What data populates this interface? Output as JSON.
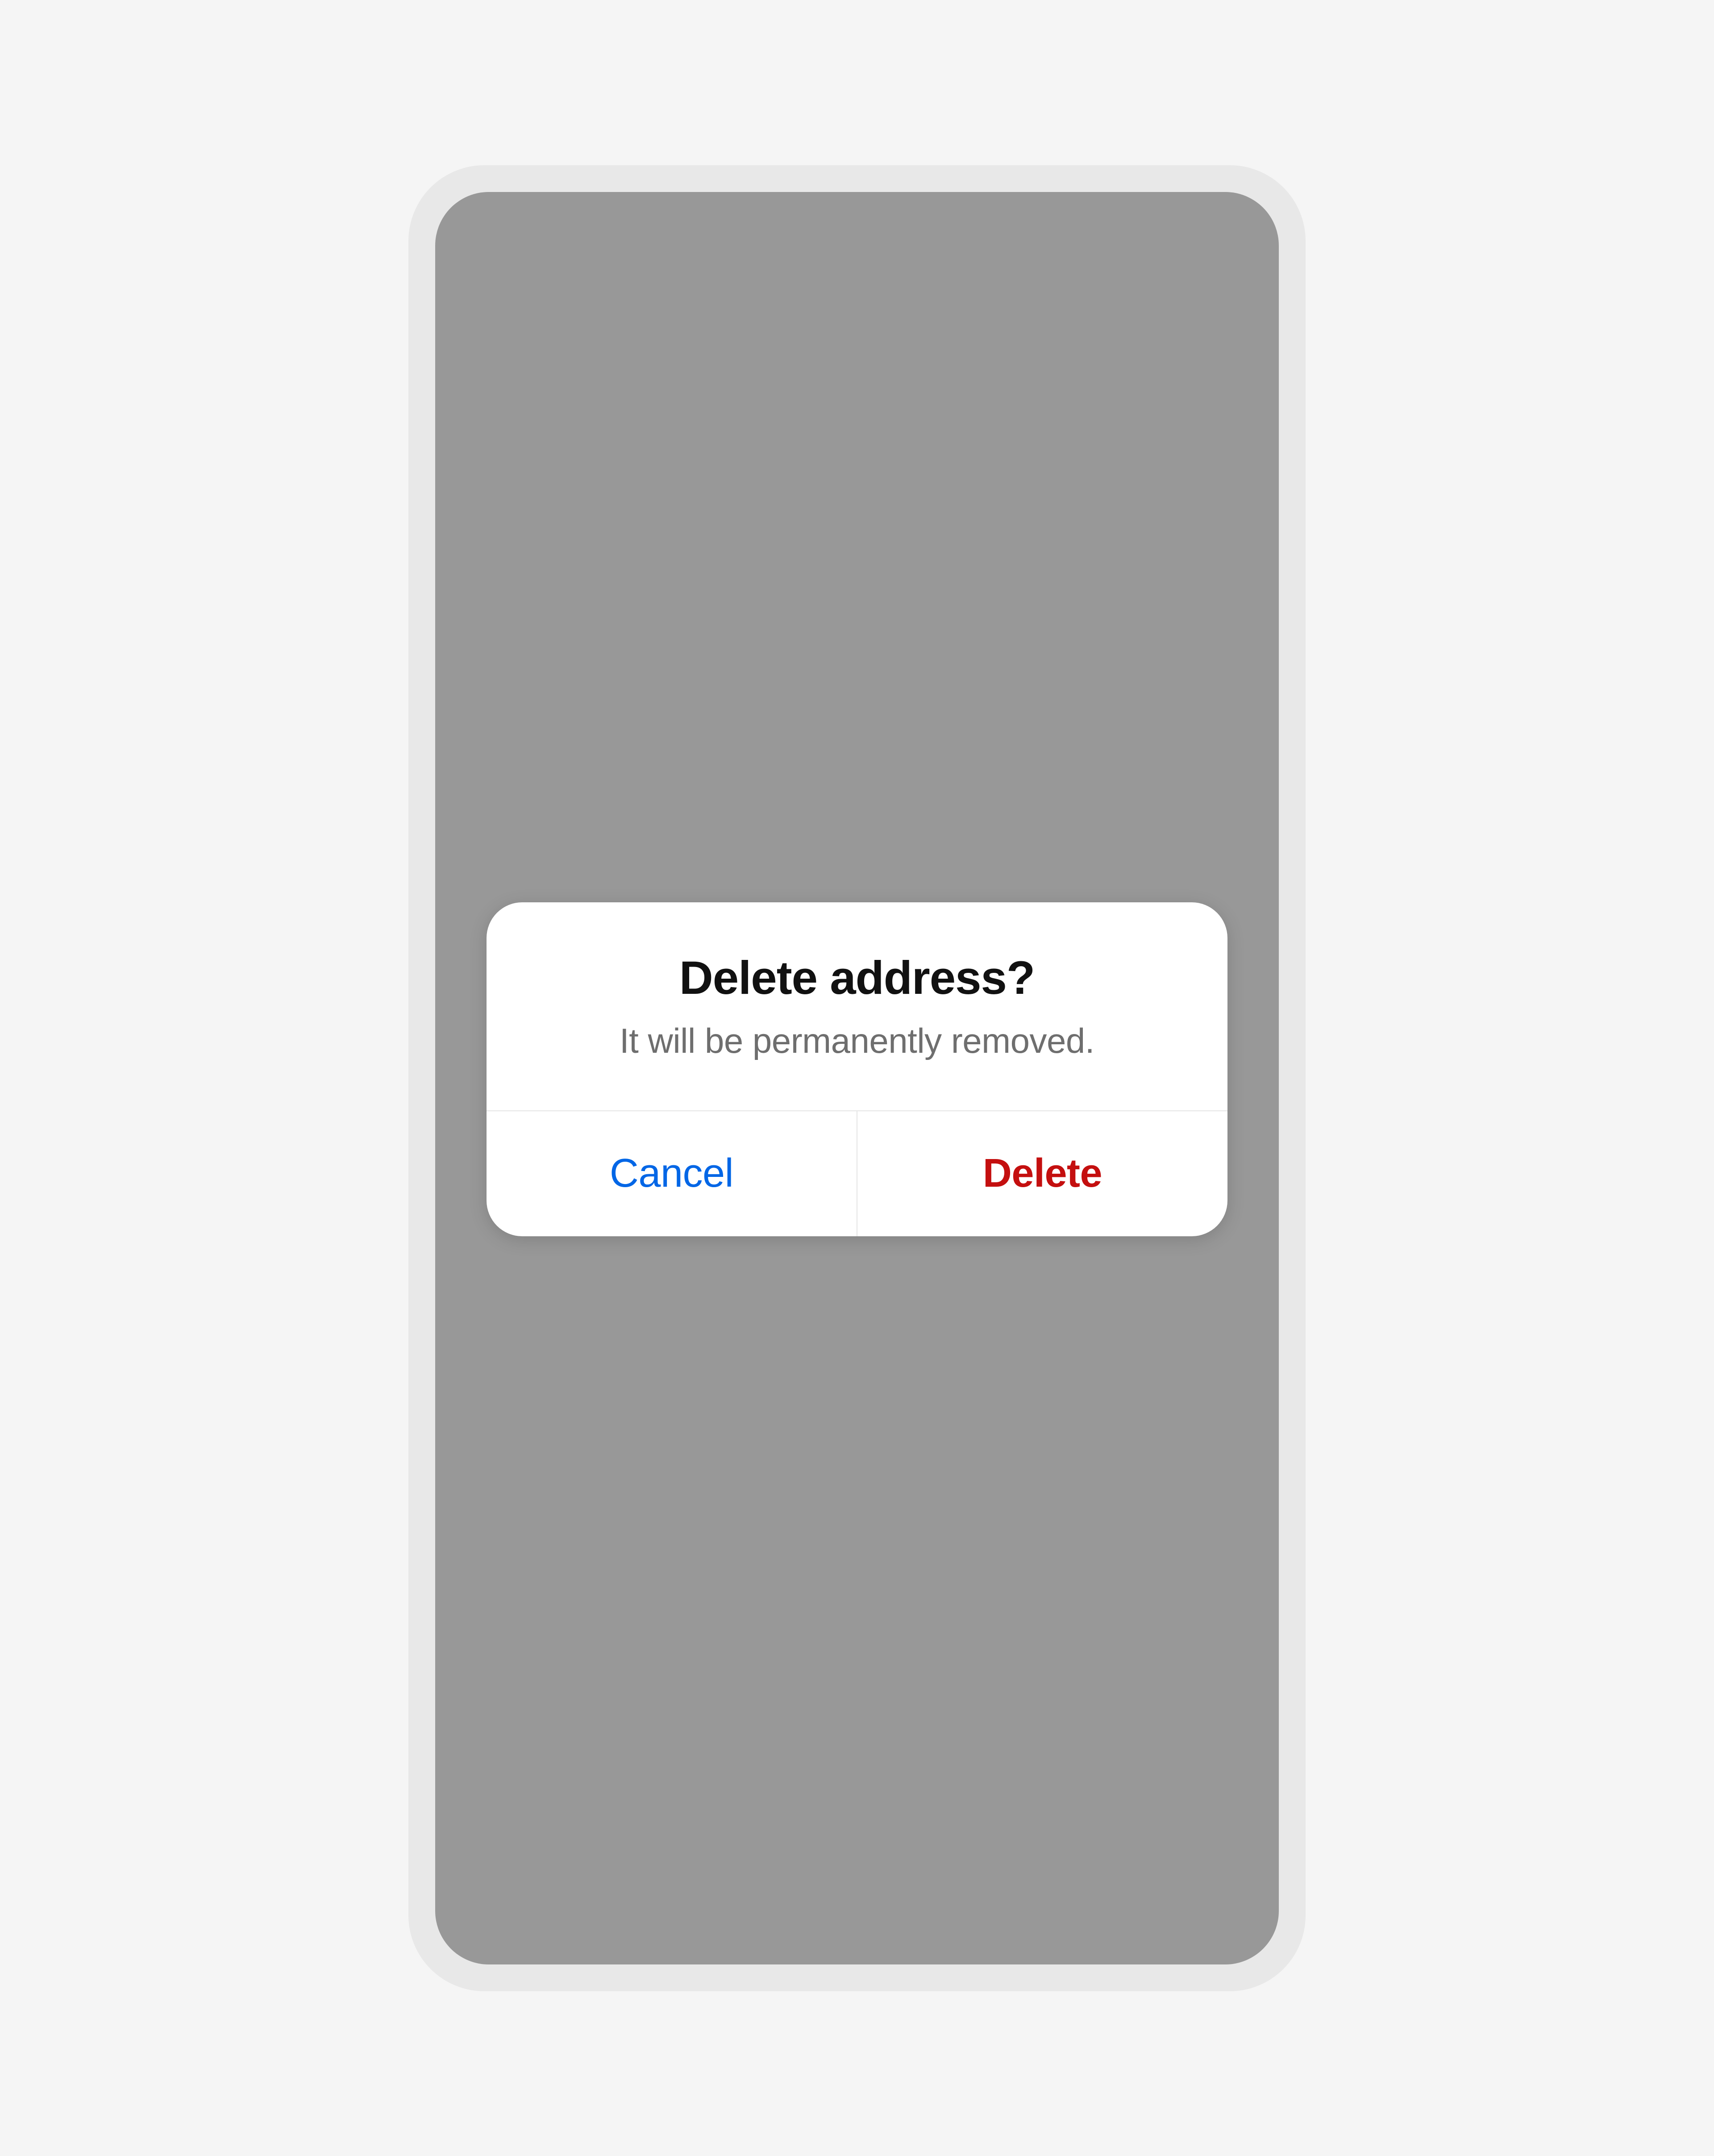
{
  "alert": {
    "title": "Delete address?",
    "message": "It will be permanently removed.",
    "cancel_label": "Cancel",
    "confirm_label": "Delete"
  }
}
